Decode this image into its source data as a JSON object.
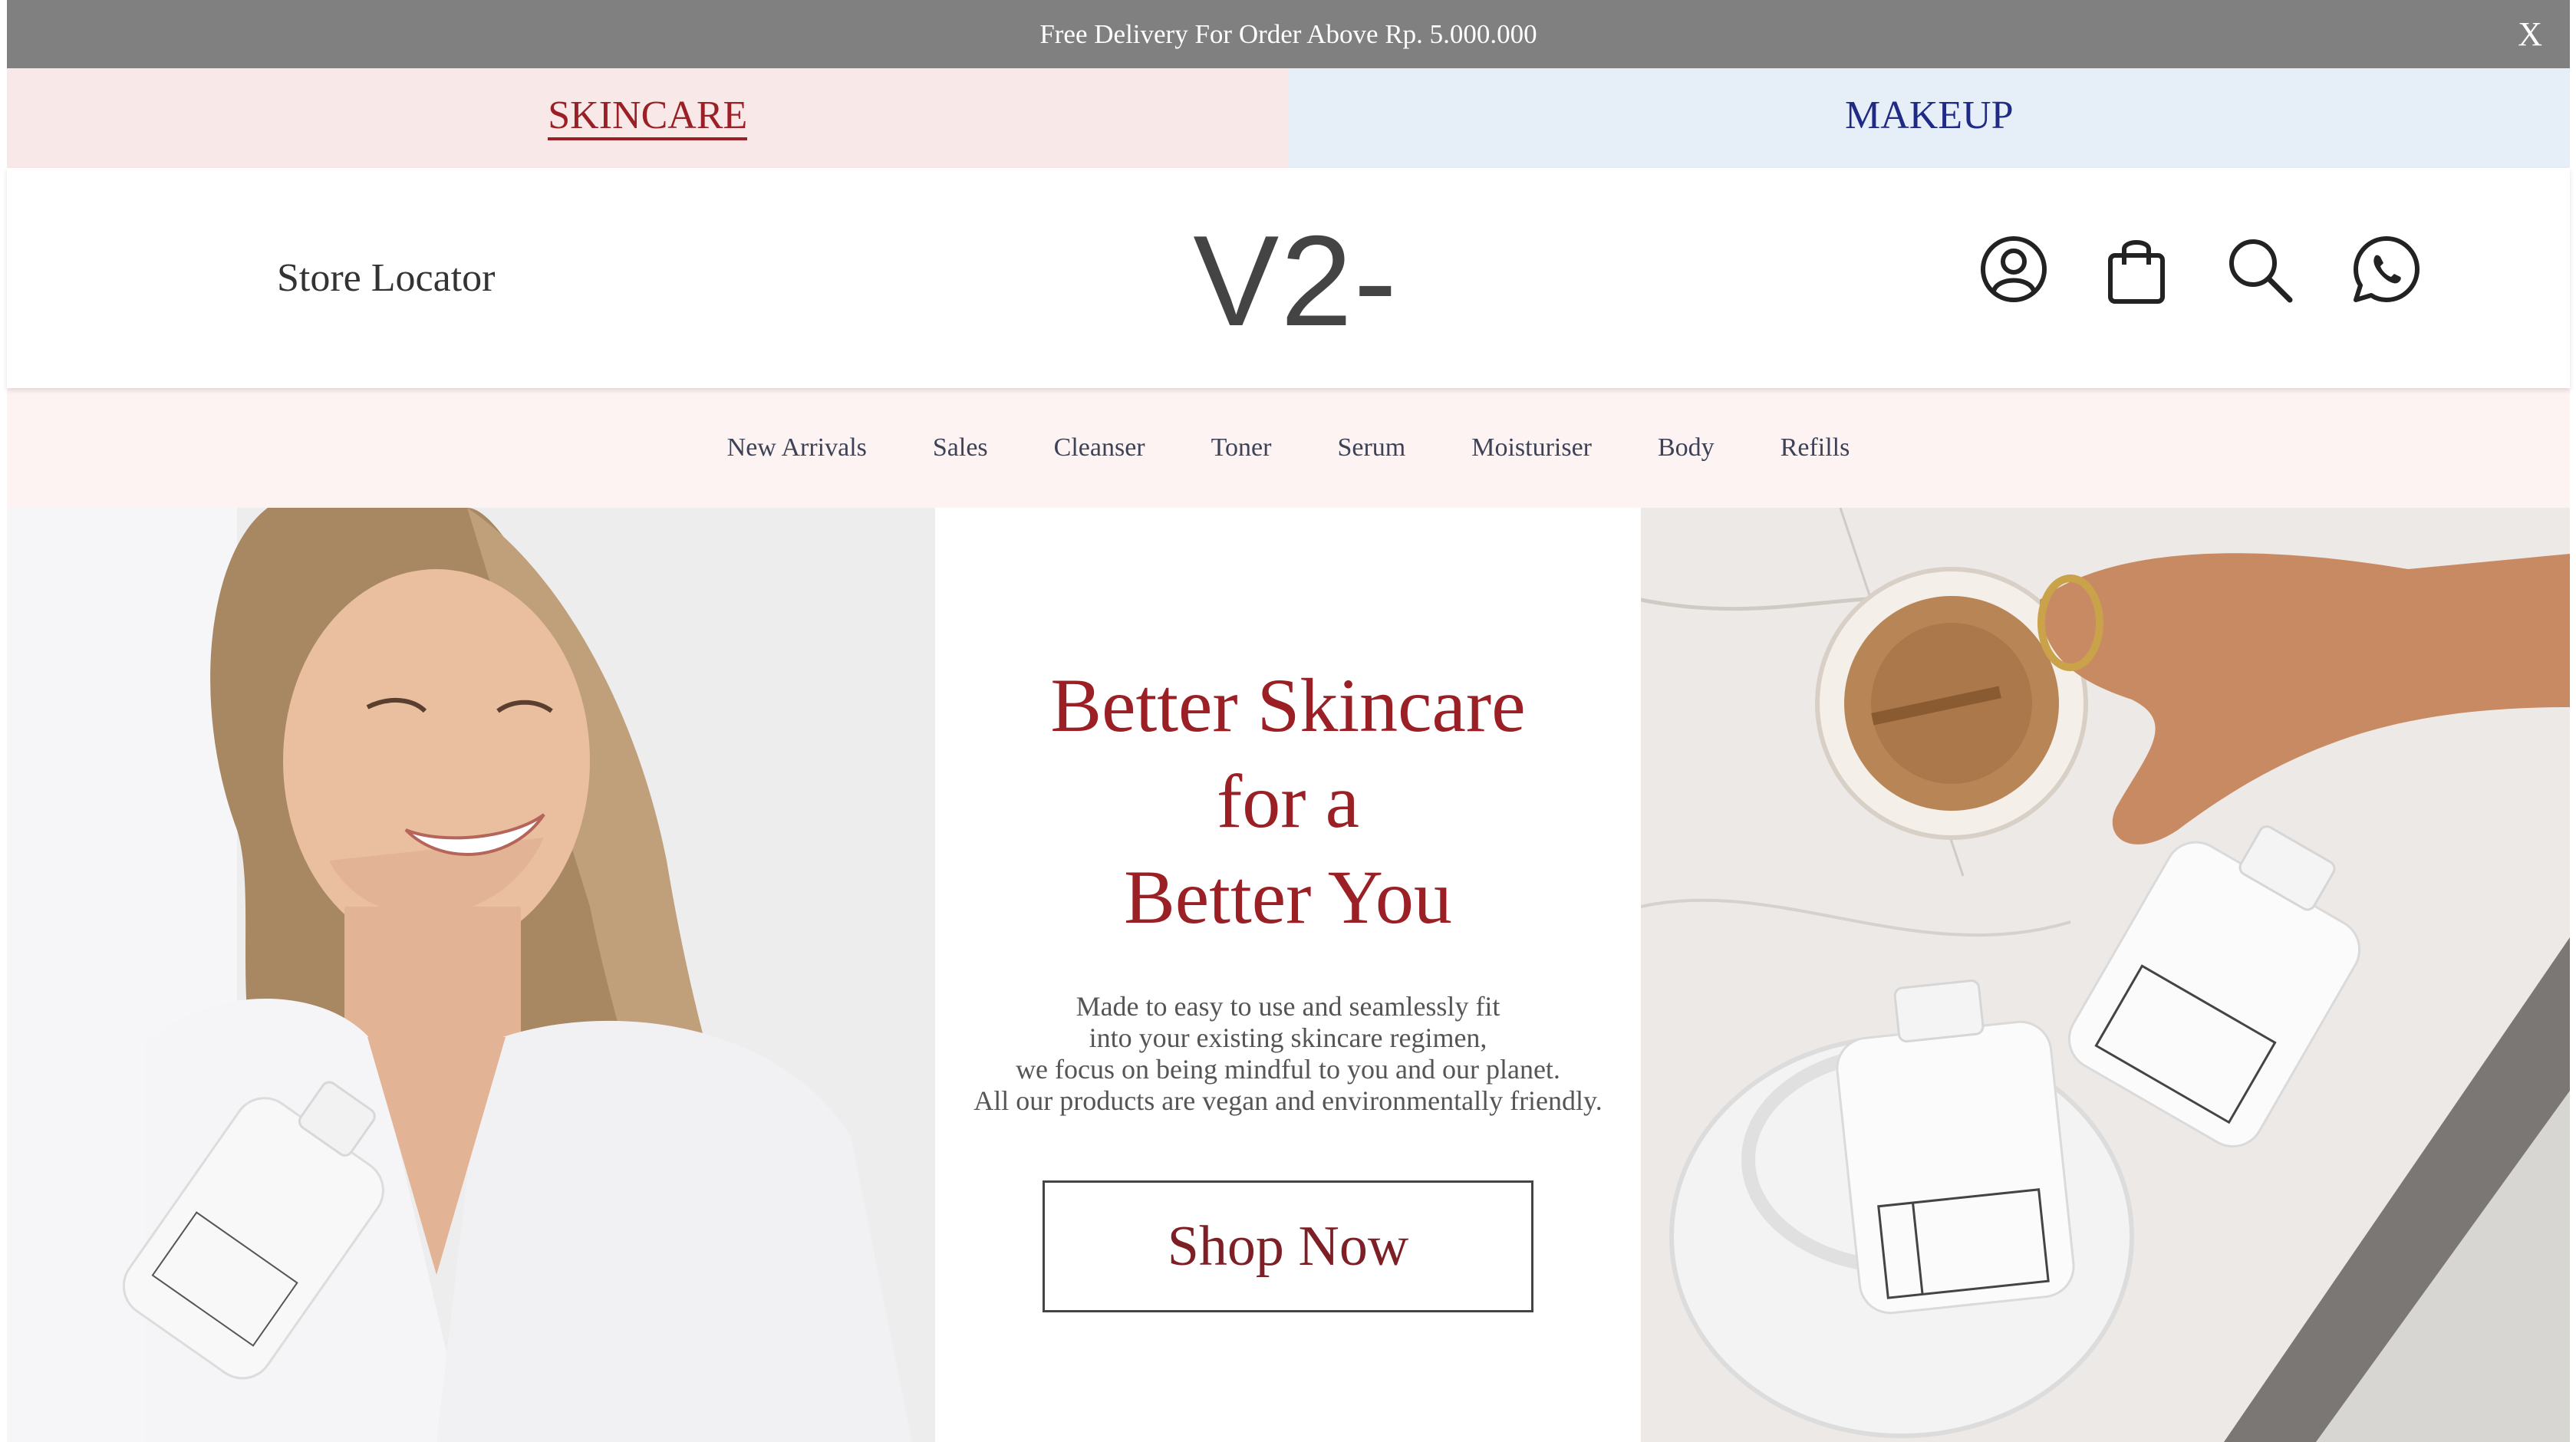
{
  "announcement": {
    "text": "Free Delivery For Order Above Rp. 5.000.000",
    "close_label": "X"
  },
  "category_tabs": [
    {
      "label": "SKINCARE",
      "active": true,
      "color": "#9b2026",
      "background": "#f8e8e8"
    },
    {
      "label": "MAKEUP",
      "active": false,
      "color": "#1f2a86",
      "background": "#e6eef7"
    }
  ],
  "header": {
    "store_locator": "Store Locator",
    "logo": "V2-",
    "icons": [
      "account-icon",
      "shopping-bag-icon",
      "search-icon",
      "whatsapp-icon"
    ]
  },
  "nav": {
    "items": [
      "New Arrivals",
      "Sales",
      "Cleanser",
      "Toner",
      "Serum",
      "Moisturiser",
      "Body",
      "Refills"
    ]
  },
  "hero": {
    "title_lines": [
      "Better Skincare",
      "for a",
      "Better You"
    ],
    "description_lines": [
      "Made to easy to use and seamlessly fit",
      "into your existing skincare regimen,",
      "we focus on being mindful to you and our planet.",
      "All our products are vegan and environmentally friendly."
    ],
    "cta_label": "Shop Now"
  },
  "colors": {
    "brand": "#9b2026",
    "announcement_bg": "#808080",
    "nav_bg": "#fcf3f2",
    "makeup_accent": "#1f2a86"
  }
}
